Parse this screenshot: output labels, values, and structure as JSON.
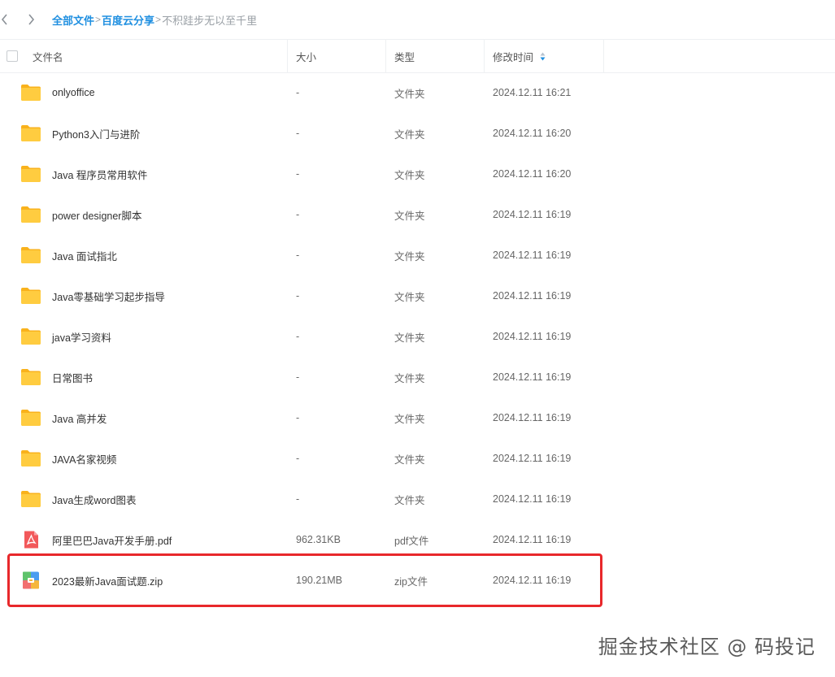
{
  "breadcrumb": {
    "items": [
      "全部文件",
      "百度云分享"
    ],
    "separator": ">",
    "current": "不积跬步无以至千里"
  },
  "columns": {
    "name": "文件名",
    "size": "大小",
    "type": "类型",
    "modified": "修改时间"
  },
  "files": [
    {
      "name": "onlyoffice",
      "size": "-",
      "type": "文件夹",
      "modified": "2024.12.11 16:21",
      "icon": "folder-icon"
    },
    {
      "name": "Python3入门与进阶",
      "size": "-",
      "type": "文件夹",
      "modified": "2024.12.11 16:20",
      "icon": "folder-icon"
    },
    {
      "name": "Java 程序员常用软件",
      "size": "-",
      "type": "文件夹",
      "modified": "2024.12.11 16:20",
      "icon": "folder-icon"
    },
    {
      "name": "power designer脚本",
      "size": "-",
      "type": "文件夹",
      "modified": "2024.12.11 16:19",
      "icon": "folder-icon"
    },
    {
      "name": "Java 面试指北",
      "size": "-",
      "type": "文件夹",
      "modified": "2024.12.11 16:19",
      "icon": "folder-icon"
    },
    {
      "name": "Java零基础学习起步指导",
      "size": "-",
      "type": "文件夹",
      "modified": "2024.12.11 16:19",
      "icon": "folder-icon"
    },
    {
      "name": "java学习资料",
      "size": "-",
      "type": "文件夹",
      "modified": "2024.12.11 16:19",
      "icon": "folder-icon"
    },
    {
      "name": "日常图书",
      "size": "-",
      "type": "文件夹",
      "modified": "2024.12.11 16:19",
      "icon": "folder-icon"
    },
    {
      "name": "Java 高并发",
      "size": "-",
      "type": "文件夹",
      "modified": "2024.12.11 16:19",
      "icon": "folder-icon"
    },
    {
      "name": "JAVA名家视频",
      "size": "-",
      "type": "文件夹",
      "modified": "2024.12.11 16:19",
      "icon": "folder-icon"
    },
    {
      "name": "Java生成word图表",
      "size": "-",
      "type": "文件夹",
      "modified": "2024.12.11 16:19",
      "icon": "folder-icon"
    },
    {
      "name": "阿里巴巴Java开发手册.pdf",
      "size": "962.31KB",
      "type": "pdf文件",
      "modified": "2024.12.11 16:19",
      "icon": "pdf-icon"
    },
    {
      "name": "2023最新Java面试题.zip",
      "size": "190.21MB",
      "type": "zip文件",
      "modified": "2024.12.11 16:19",
      "icon": "zip-icon"
    }
  ],
  "watermark": "掘金技术社区 @ 码投记",
  "colors": {
    "link": "#1f8fe0",
    "folder": "#ffc93c",
    "highlight": "#e8282b",
    "pdf": "#f2585a"
  }
}
